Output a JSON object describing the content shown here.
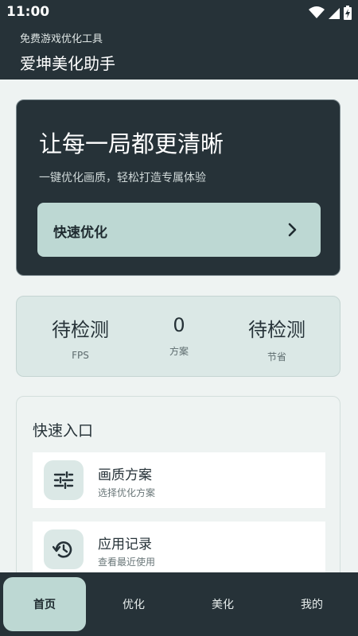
{
  "status_bar": {
    "time": "11:00"
  },
  "app_bar": {
    "subtitle": "免费游戏优化工具",
    "title": "爱坤美化助手"
  },
  "hero": {
    "headline": "让每一局都更清晰",
    "description": "一键优化画质，轻松打造专属体验",
    "button_label": "快速优化"
  },
  "stats": [
    {
      "value": "待检测",
      "label": "FPS"
    },
    {
      "value": "0",
      "label": "方案"
    },
    {
      "value": "待检测",
      "label": "节省"
    }
  ],
  "quick_entry": {
    "title": "快速入口",
    "items": [
      {
        "title": "画质方案",
        "subtitle": "选择优化方案",
        "icon": "sliders-icon"
      },
      {
        "title": "应用记录",
        "subtitle": "查看最近使用",
        "icon": "history-icon"
      }
    ]
  },
  "bottom_nav": {
    "tabs": [
      {
        "label": "首页",
        "active": true
      },
      {
        "label": "优化",
        "active": false
      },
      {
        "label": "美化",
        "active": false
      },
      {
        "label": "我的",
        "active": false
      }
    ]
  },
  "colors": {
    "dark": "#263238",
    "accent": "#bdd8d3",
    "background": "#eef3f2"
  }
}
